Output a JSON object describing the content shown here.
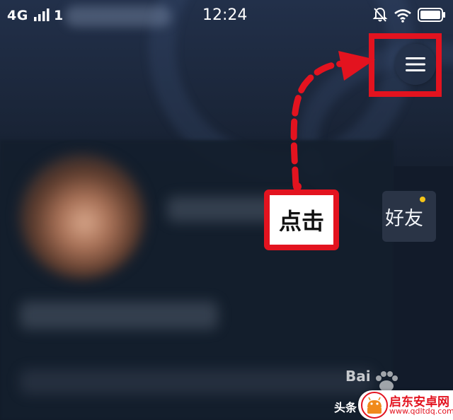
{
  "status_bar": {
    "network": "4G",
    "sim_index": "1",
    "time": "12:24"
  },
  "profile": {
    "friend_button_label": "好友"
  },
  "annotation": {
    "callout_label": "点击"
  },
  "watermark": {
    "source_label": "头条",
    "site_name": "启东安卓网",
    "site_url": "www.qdltdq.com"
  },
  "colors": {
    "annotation_red": "#e3131f",
    "notification_dot": "#f5c518",
    "header_bg": "#22304a",
    "panel_bg": "#141d2c"
  },
  "icons": {
    "menu": "hamburger-menu-icon",
    "signal": "signal-bars-icon",
    "mute": "bell-muted-icon",
    "wifi": "wifi-icon",
    "battery": "battery-icon",
    "watermark_logo": "paw-icon",
    "site_logo": "android-robot-icon"
  }
}
